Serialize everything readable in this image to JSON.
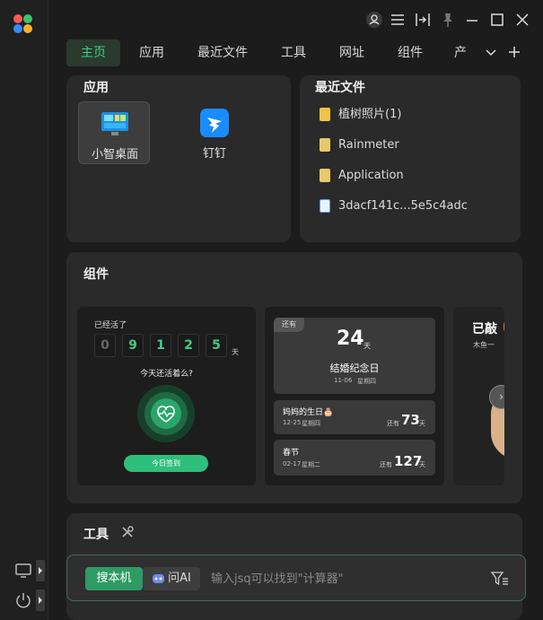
{
  "window": {
    "user_icon": "user-icon",
    "menu_icon": "menu-icon",
    "dock_icon": "dock-side-icon",
    "pin_icon": "pin-icon",
    "minimize_icon": "minimize-icon",
    "maximize_icon": "maximize-icon",
    "close_icon": "close-icon"
  },
  "tabs": [
    {
      "label": "主页"
    },
    {
      "label": "应用"
    },
    {
      "label": "最近文件"
    },
    {
      "label": "工具"
    },
    {
      "label": "网址"
    },
    {
      "label": "组件"
    },
    {
      "label": "产"
    }
  ],
  "apps_section": {
    "title": "应用",
    "items": [
      {
        "label": "小智桌面",
        "icon": "desktop-app-icon"
      },
      {
        "label": "钉钉",
        "icon": "dingtalk-icon"
      }
    ]
  },
  "recent_section": {
    "title": "最近文件",
    "items": [
      {
        "name": "植树照片(1)",
        "icon": "image-file-icon"
      },
      {
        "name": "Rainmeter",
        "icon": "file-icon"
      },
      {
        "name": "Application",
        "icon": "file-icon"
      },
      {
        "name": "3dacf141c...5e5c4adc",
        "icon": "doc-file-icon"
      }
    ]
  },
  "widgets_section": {
    "title": "组件",
    "alive_widget": {
      "caption": "已经活了",
      "digits": [
        "0",
        "9",
        "1",
        "2",
        "5"
      ],
      "unit": "天",
      "question": "今天还活着么?",
      "button": "今日签到"
    },
    "countdown_widget": {
      "badge": "还有",
      "main_days": "24",
      "main_unit": "天",
      "main_title": "结婚纪念日",
      "main_date": "11-06",
      "main_weekday": "星期四",
      "events": [
        {
          "title": "妈妈的生日🎂",
          "date": "12-25",
          "weekday": "星期四",
          "prefix": "还有",
          "days": "73",
          "unit": "天"
        },
        {
          "title": "春节",
          "date": "02-17",
          "weekday": "星期二",
          "prefix": "还有",
          "days": "127",
          "unit": "天"
        }
      ]
    },
    "third_widget": {
      "title": "已敲",
      "subtitle": "木鱼一"
    }
  },
  "tools_section": {
    "title": "工具"
  },
  "search": {
    "tab_active": "搜本机",
    "tab_ai": "问AI",
    "placeholder": "输入jsq可以找到\"计算器\""
  },
  "colors": {
    "accent": "#2e9a64",
    "accent_text": "#3fce86",
    "background": "#1c1c1c",
    "card": "#2a2a2a"
  }
}
